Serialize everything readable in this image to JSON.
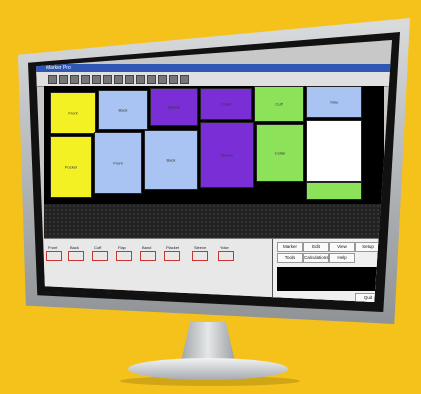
{
  "app": {
    "title": "Marker Pro"
  },
  "toolbar": {
    "icons": [
      "new-icon",
      "open-icon",
      "save-icon",
      "print-icon",
      "cut-icon",
      "zoom-in-icon",
      "zoom-out-icon",
      "rotate-icon",
      "flip-icon",
      "settings-icon",
      "grid-icon",
      "undo-icon",
      "redo-icon"
    ]
  },
  "pieces": {
    "labels": [
      "Front",
      "Back",
      "Sleeve",
      "Collar",
      "Cuff",
      "Yoke",
      "Pocket",
      "Front",
      "Back",
      "Sleeve",
      "Collar"
    ]
  },
  "piecebar": {
    "items": [
      "Front",
      "Back",
      "Cuff",
      "Flap",
      "Band",
      "Placket",
      "Sleeve",
      "Yoke"
    ]
  },
  "menu": {
    "marker": "Marker",
    "edit": "Edit",
    "view": "View",
    "setup": "Setup",
    "tools": "Tools",
    "calc": "Calculations",
    "help": "Help",
    "quit": "Quit"
  },
  "status": {
    "coords": "71,96  77.69",
    "util": "86",
    "field": "Util.",
    "pieces": "Clk Best Pos"
  },
  "colors": {
    "yellow": "#f3f024",
    "lightblue": "#a9c4f2",
    "purple": "#7a2fd6",
    "green": "#8ce35a",
    "white": "#ffffff"
  }
}
